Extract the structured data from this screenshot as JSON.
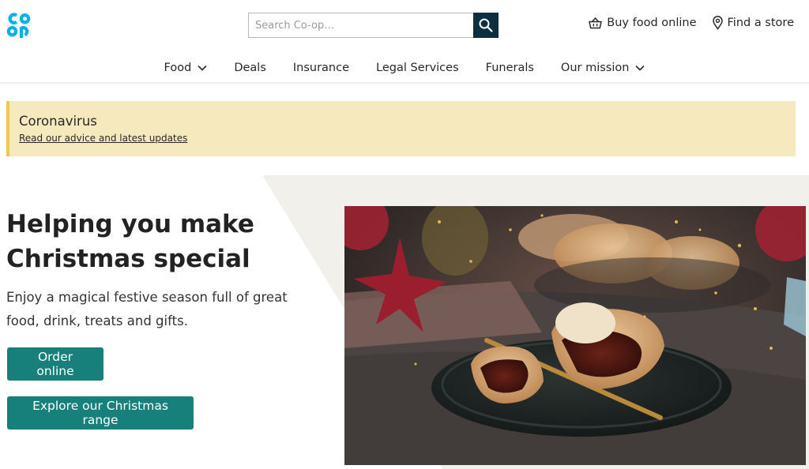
{
  "brand": {
    "logo_text": "co op",
    "brand_color": "#00b1e7"
  },
  "search": {
    "placeholder": "Search Co-op…",
    "icon": "search-icon"
  },
  "top_links": {
    "buy_food": "Buy food online",
    "find_store": "Find a store"
  },
  "nav": {
    "food": "Food",
    "deals": "Deals",
    "insurance": "Insurance",
    "legal": "Legal Services",
    "funerals": "Funerals",
    "mission": "Our mission"
  },
  "banner": {
    "title": "Coronavirus",
    "link": "Read our advice and latest updates"
  },
  "hero": {
    "title": "Helping you make Christmas special",
    "subtitle": "Enjoy a magical festive season full of great food, drink, treats and gifts.",
    "order_button": "Order online",
    "explore_button": "Explore our Christmas range"
  },
  "colors": {
    "button": "#18807a",
    "search_button": "#0b2f3f",
    "banner_bg": "#f6e9bd",
    "banner_accent": "#f0c64b"
  }
}
